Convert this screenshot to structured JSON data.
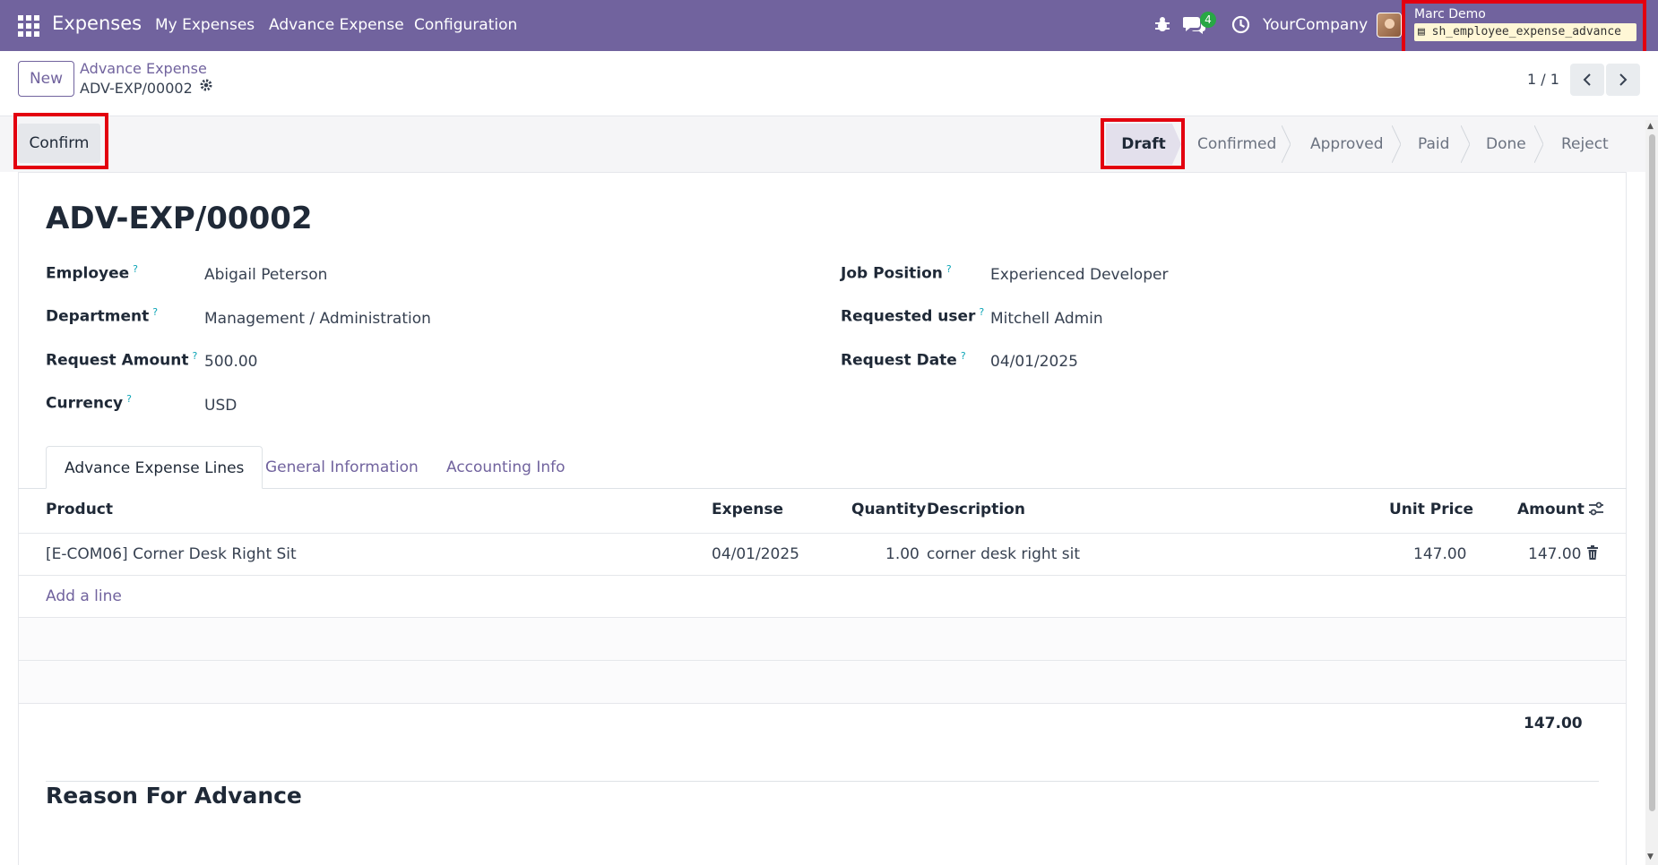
{
  "navbar": {
    "brand": "Expenses",
    "menu": [
      "My Expenses",
      "Advance Expense",
      "Configuration"
    ],
    "messages_count": "4",
    "company": "YourCompany",
    "user_name": "Marc Demo",
    "db_name": "sh_employee_expense_advance"
  },
  "control": {
    "new_label": "New",
    "breadcrumb_parent": "Advance Expense",
    "breadcrumb_current": "ADV-EXP/00002",
    "pager": "1 / 1"
  },
  "status": {
    "confirm_label": "Confirm",
    "stages": [
      "Draft",
      "Confirmed",
      "Approved",
      "Paid",
      "Done",
      "Reject"
    ],
    "current_stage": "Draft"
  },
  "form": {
    "title": "ADV-EXP/00002",
    "employee_label": "Employee",
    "employee": "Abigail Peterson",
    "department_label": "Department",
    "department": "Management / Administration",
    "request_amount_label": "Request Amount",
    "request_amount": "500.00",
    "currency_label": "Currency",
    "currency": "USD",
    "job_position_label": "Job Position",
    "job_position": "Experienced Developer",
    "requested_user_label": "Requested user",
    "requested_user": "Mitchell Admin",
    "request_date_label": "Request Date",
    "request_date": "04/01/2025",
    "help_mark": "?"
  },
  "tabs": [
    "Advance Expense Lines",
    "General Information",
    "Accounting Info"
  ],
  "lines": {
    "headers": {
      "product": "Product",
      "expense": "Expense",
      "quantity": "Quantity",
      "description": "Description",
      "unit_price": "Unit Price",
      "amount": "Amount"
    },
    "rows": [
      {
        "product": "[E-COM06] Corner Desk Right Sit",
        "expense": "04/01/2025",
        "quantity": "1.00",
        "description": "corner desk right sit",
        "unit_price": "147.00",
        "amount": "147.00"
      }
    ],
    "add_line": "Add a line",
    "total": "147.00"
  },
  "reason": {
    "title": "Reason For Advance"
  },
  "colors": {
    "navbar": "#71639e",
    "highlight": "#e3000f",
    "accent": "#71639e"
  }
}
